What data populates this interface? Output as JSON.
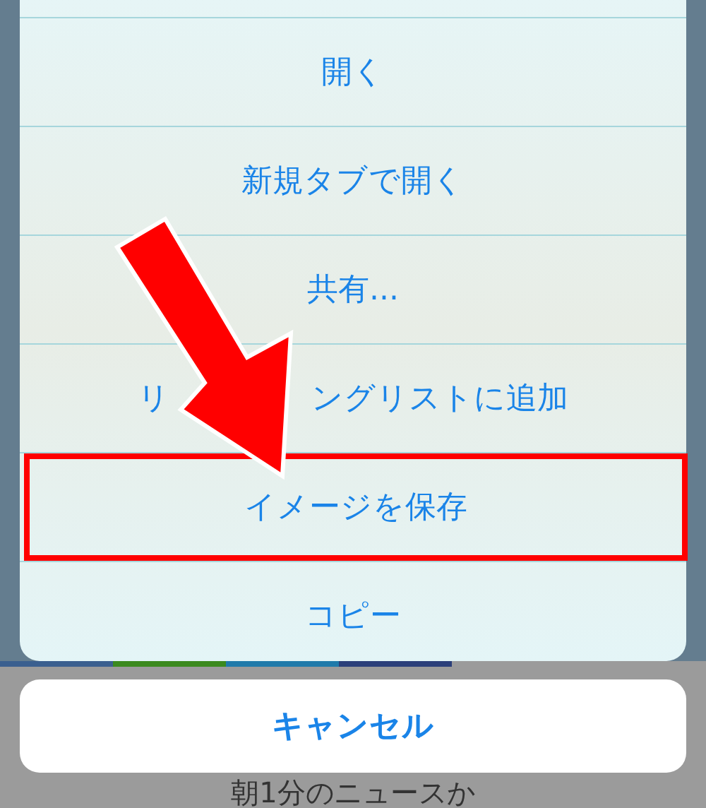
{
  "action_sheet": {
    "items": [
      {
        "label": "開く",
        "highlighted": false
      },
      {
        "label": "新規タブで開く",
        "highlighted": false
      },
      {
        "label": "共有...",
        "highlighted": false
      },
      {
        "visible_parts": [
          "リ",
          "ングリストに追加"
        ],
        "highlighted": false
      },
      {
        "label": "イメージを保存",
        "highlighted": true
      },
      {
        "label": "コピー",
        "highlighted": false
      }
    ],
    "cancel": "キャンセル"
  },
  "annotations": [
    {
      "kind": "arrow"
    }
  ],
  "background_text": "朝1分のニュースか"
}
